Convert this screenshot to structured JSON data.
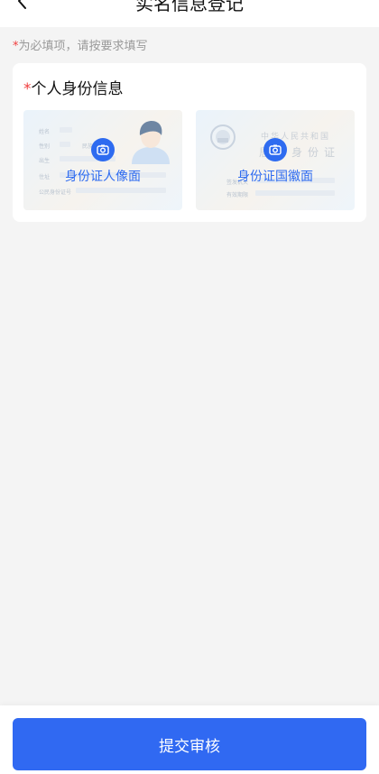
{
  "header": {
    "title": "实名信息登记",
    "back_icon": "chevron-left-icon"
  },
  "notice": {
    "asterisk": "*",
    "text": "为必填项，请按要求填写"
  },
  "section": {
    "asterisk": "*",
    "title": "个人身份信息",
    "front": {
      "caption": "身份证人像面",
      "icon": "camera-icon",
      "field_labels": [
        "姓名",
        "性别",
        "出生",
        "住址",
        "公民身份证号"
      ],
      "inline_label": "民族"
    },
    "back": {
      "caption": "身份证国徽面",
      "icon": "camera-icon",
      "title_line1": "中华人民共和国",
      "title_line2": "居民身份证",
      "field_labels": [
        "签发机关",
        "有效期限"
      ]
    }
  },
  "footer": {
    "submit_label": "提交审核"
  },
  "colors": {
    "accent": "#3069f2",
    "required": "#f03e3e",
    "background": "#f4f4f4"
  }
}
